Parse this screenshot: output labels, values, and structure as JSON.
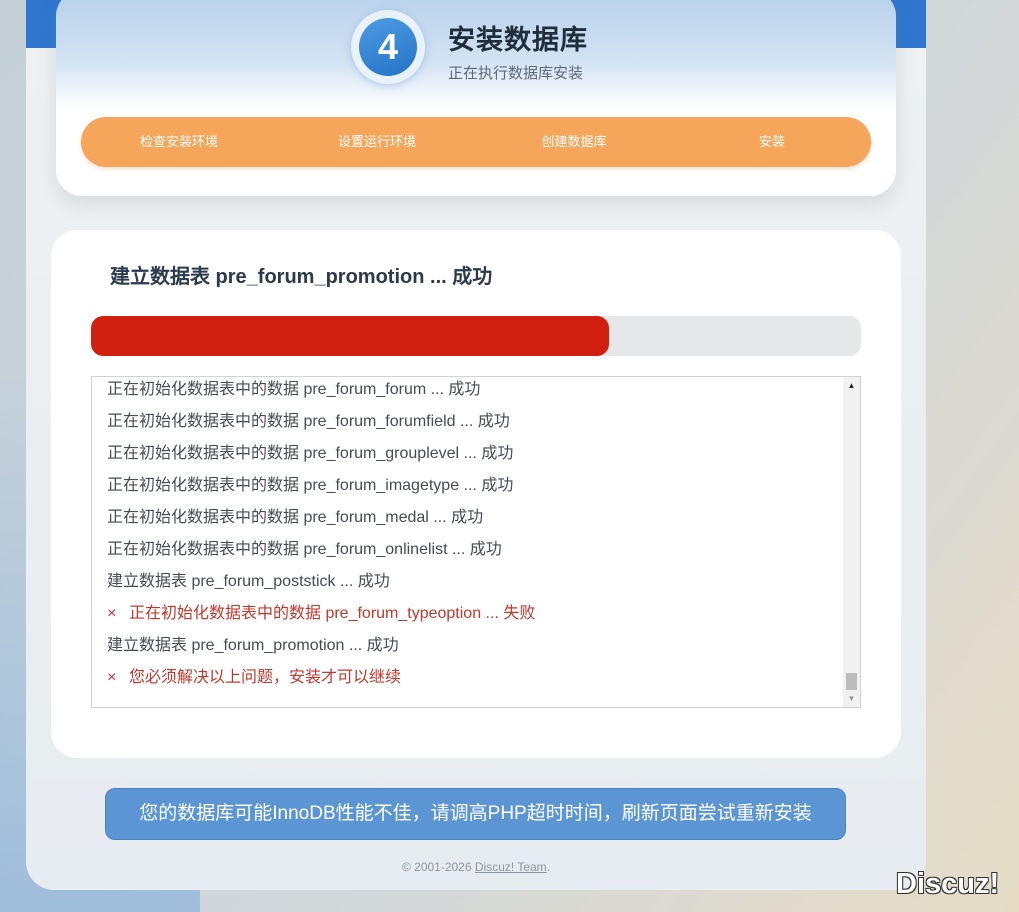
{
  "header": {
    "step_number": "4",
    "title": "安装数据库",
    "subtitle": "正在执行数据库安装"
  },
  "nav": {
    "items": [
      {
        "label": "检查安装环境"
      },
      {
        "label": "设置运行环境"
      },
      {
        "label": "创建数据库"
      },
      {
        "label": "安装"
      }
    ]
  },
  "main": {
    "status_text": "建立数据表 pre_forum_promotion ... 成功",
    "progress_percent": 67.3,
    "log": [
      {
        "text": "正在初始化数据表中的数据 pre_forum_forum ... 成功",
        "error": false
      },
      {
        "text": "正在初始化数据表中的数据 pre_forum_forumfield ... 成功",
        "error": false
      },
      {
        "text": "正在初始化数据表中的数据 pre_forum_grouplevel ... 成功",
        "error": false
      },
      {
        "text": "正在初始化数据表中的数据 pre_forum_imagetype ... 成功",
        "error": false
      },
      {
        "text": "正在初始化数据表中的数据 pre_forum_medal ... 成功",
        "error": false
      },
      {
        "text": "正在初始化数据表中的数据 pre_forum_onlinelist ... 成功",
        "error": false
      },
      {
        "text": "建立数据表 pre_forum_poststick ... 成功",
        "error": false
      },
      {
        "text": "正在初始化数据表中的数据 pre_forum_typeoption ... 失败",
        "error": true
      },
      {
        "text": "建立数据表 pre_forum_promotion ... 成功",
        "error": false
      },
      {
        "text": "您必须解决以上问题，安装才可以继续",
        "error": true
      }
    ],
    "error_mark": "×"
  },
  "alert": {
    "text": "您的数据库可能InnoDB性能不佳，请调高PHP超时时间，刷新页面尝试重新安装"
  },
  "footer": {
    "copyright": "© 2001-2026 ",
    "link_text": "Discuz! Team",
    "suffix": "."
  },
  "watermark": {
    "text": "Discuz!"
  },
  "colors": {
    "accent_blue": "#2f76cf",
    "nav_orange": "#f5a65a",
    "progress_red": "#d11f10",
    "error_red": "#c0392b",
    "alert_blue": "#5b95d4"
  }
}
